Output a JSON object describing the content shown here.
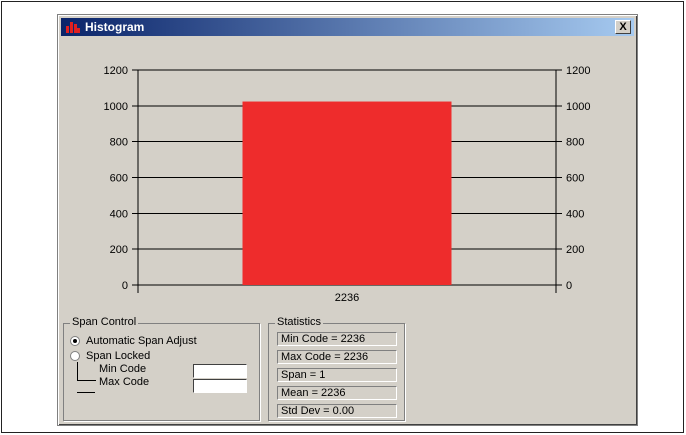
{
  "window": {
    "title": "Histogram",
    "close_glyph": "X"
  },
  "chart_data": {
    "type": "bar",
    "categories": [
      "2236"
    ],
    "values": [
      1024
    ],
    "ylim": [
      0,
      1200
    ],
    "yticks": [
      "0",
      "200",
      "400",
      "600",
      "800",
      "1000",
      "1200"
    ],
    "bar_color": "#ee2c2c",
    "grid": true,
    "title": "",
    "xlabel": "",
    "ylabel": ""
  },
  "span_control": {
    "title": "Span Control",
    "auto_label": "Automatic Span Adjust",
    "locked_label": "Span Locked",
    "min_label": "Min Code",
    "max_label": "Max Code",
    "min_value": "",
    "max_value": "",
    "selected": "auto"
  },
  "statistics": {
    "title": "Statistics",
    "min_code": "Min Code =  2236",
    "max_code": "Max Code =  2236",
    "span": "Span =  1",
    "mean": "Mean =  2236",
    "std_dev": "Std Dev = 0.00"
  },
  "colors": {
    "titlebar_start": "#0a246a",
    "titlebar_end": "#a6caf0",
    "bar": "#ee2c2c"
  },
  "icons": {
    "title_icon": "histogram-app-icon"
  }
}
